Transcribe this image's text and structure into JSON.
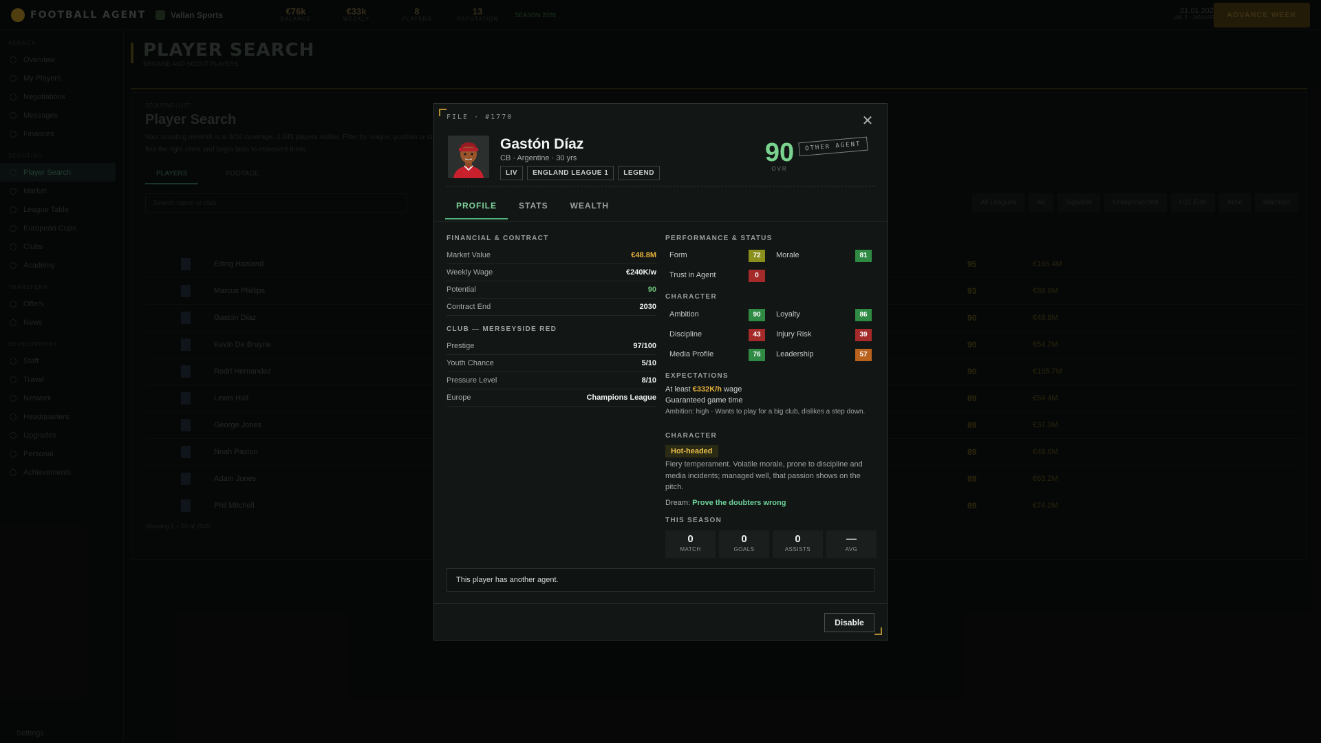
{
  "app": {
    "brand": "FOOTBALL AGENT",
    "agency": "Vallan Sports",
    "stats": [
      {
        "value": "€76k",
        "label": "BALANCE"
      },
      {
        "value": "€33k",
        "label": "WEEKLY"
      },
      {
        "value": "8",
        "label": "PLAYERS"
      },
      {
        "value": "13",
        "label": "REPUTATION"
      }
    ],
    "season": "SEASON 2026",
    "date": "21.01.2026",
    "date_sub": "WK 3 · JANUARY",
    "cta": "ADVANCE WEEK"
  },
  "sidebar": {
    "groups": [
      {
        "label": "AGENCY",
        "items": [
          "Overview",
          "My Players",
          "Negotiations",
          "Messages",
          "Finances"
        ]
      },
      {
        "label": "SCOUTING",
        "items": [
          "Player Search",
          "Market",
          "League Table",
          "European Cups",
          "Clubs",
          "Academy"
        ]
      },
      {
        "label": "TRANSFERS",
        "items": [
          "Offers",
          "News"
        ]
      },
      {
        "label": "DEVELOPMENT",
        "items": [
          "Staff",
          "Travel",
          "Network",
          "Headquarters",
          "Upgrades",
          "Personal",
          "Achievements"
        ]
      }
    ],
    "active": "Player Search",
    "settings": "Settings"
  },
  "page": {
    "title": "PLAYER SEARCH",
    "subtitle": "BROWSE AND SCOUT PLAYERS",
    "crumb": "SCOUTING / LIST",
    "panel_title": "Player Search",
    "panel_desc": "Your scouting network is at 6/10 coverage. 2,345 players visible. Filter by league, position or status to find the right client and begin talks to represent them.",
    "tabs": [
      "PLAYERS",
      "FOOTAGE"
    ],
    "search_placeholder": "Search name or club",
    "filters": [
      "All Leagues",
      "All",
      "Signable",
      "Unrepresented",
      "U21 Elite",
      "Mine",
      "Watched"
    ],
    "rows": [
      {
        "name": "Erling Haaland",
        "ovr": "95",
        "value": "€165.4M"
      },
      {
        "name": "Marcus Phillips",
        "ovr": "93",
        "value": "€88.6M"
      },
      {
        "name": "Gastón Díaz",
        "ovr": "90",
        "value": "€48.8M"
      },
      {
        "name": "Kevin De Bruyne",
        "ovr": "90",
        "value": "€54.7M"
      },
      {
        "name": "Rodri Hernandez",
        "ovr": "90",
        "value": "€105.7M"
      },
      {
        "name": "Lewis Hall",
        "ovr": "89",
        "value": "€54.4M"
      },
      {
        "name": "George Jones",
        "ovr": "89",
        "value": "€37.3M"
      },
      {
        "name": "Noah Paxton",
        "ovr": "89",
        "value": "€48.6M"
      },
      {
        "name": "Adam Jones",
        "ovr": "89",
        "value": "€63.2M"
      },
      {
        "name": "Phil Mitchell",
        "ovr": "89",
        "value": "€74.0M"
      }
    ],
    "pagination": "Showing 1 – 10 of 2345"
  },
  "modal": {
    "file_no": "FILE · #1770",
    "player": {
      "name": "Gastón Díaz",
      "meta": "CB · Argentine · 30 yrs",
      "tags": [
        "LIV",
        "ENGLAND LEAGUE 1",
        "LEGEND"
      ],
      "ovr": "90",
      "ovr_label": "OVR",
      "agent_stamp": "OTHER AGENT"
    },
    "tabs": [
      "PROFILE",
      "STATS",
      "WEALTH"
    ],
    "active_tab": "PROFILE",
    "financial": {
      "title": "FINANCIAL & CONTRACT",
      "rows": [
        {
          "k": "Market Value",
          "v": "€48.8M",
          "color": "#e7b33c"
        },
        {
          "k": "Weekly Wage",
          "v": "€240K/w",
          "color": "#eef1ef"
        },
        {
          "k": "Potential",
          "v": "90",
          "color": "#6ec37f"
        },
        {
          "k": "Contract End",
          "v": "2030",
          "color": "#eef1ef"
        }
      ]
    },
    "club": {
      "title": "CLUB — MERSEYSIDE RED",
      "rows": [
        {
          "k": "Prestige",
          "v": "97/100"
        },
        {
          "k": "Youth Chance",
          "v": "5/10"
        },
        {
          "k": "Pressure Level",
          "v": "8/10"
        },
        {
          "k": "Europe",
          "v": "Champions League"
        }
      ]
    },
    "performance": {
      "title": "PERFORMANCE & STATUS",
      "items": [
        {
          "k": "Form",
          "v": "72",
          "color": "#8b8f1c"
        },
        {
          "k": "Morale",
          "v": "81",
          "color": "#2f8a43"
        },
        {
          "k": "Trust in Agent",
          "v": "0",
          "color": "#a52a2a"
        }
      ]
    },
    "character_attrs": {
      "title": "CHARACTER",
      "items": [
        {
          "k": "Ambition",
          "v": "90",
          "color": "#2f8a43"
        },
        {
          "k": "Loyalty",
          "v": "86",
          "color": "#2f8a43"
        },
        {
          "k": "Discipline",
          "v": "43",
          "color": "#a52a2a"
        },
        {
          "k": "Injury Risk",
          "v": "39",
          "color": "#a52a2a"
        },
        {
          "k": "Media Profile",
          "v": "76",
          "color": "#2f8a43"
        },
        {
          "k": "Leadership",
          "v": "57",
          "color": "#b8621e"
        }
      ]
    },
    "expectations": {
      "title": "EXPECTATIONS",
      "wage_prefix": "At least",
      "wage_value": "€332K/h",
      "wage_suffix": "wage",
      "line2": "Guaranteed game time",
      "note": "Ambition: high · Wants to play for a big club, dislikes a step down."
    },
    "character": {
      "title": "CHARACTER",
      "trait": "Hot-headed",
      "description": "Fiery temperament. Volatile morale, prone to discipline and media incidents; managed well, that passion shows on the pitch.",
      "dream_label": "Dream:",
      "dream_value": "Prove the doubters wrong"
    },
    "season": {
      "title": "THIS SEASON",
      "boxes": [
        {
          "n": "0",
          "l": "MATCH"
        },
        {
          "n": "0",
          "l": "GOALS"
        },
        {
          "n": "0",
          "l": "ASSISTS"
        },
        {
          "n": "—",
          "l": "AVG"
        }
      ]
    },
    "notice": "This player has another agent.",
    "disable_label": "Disable"
  }
}
